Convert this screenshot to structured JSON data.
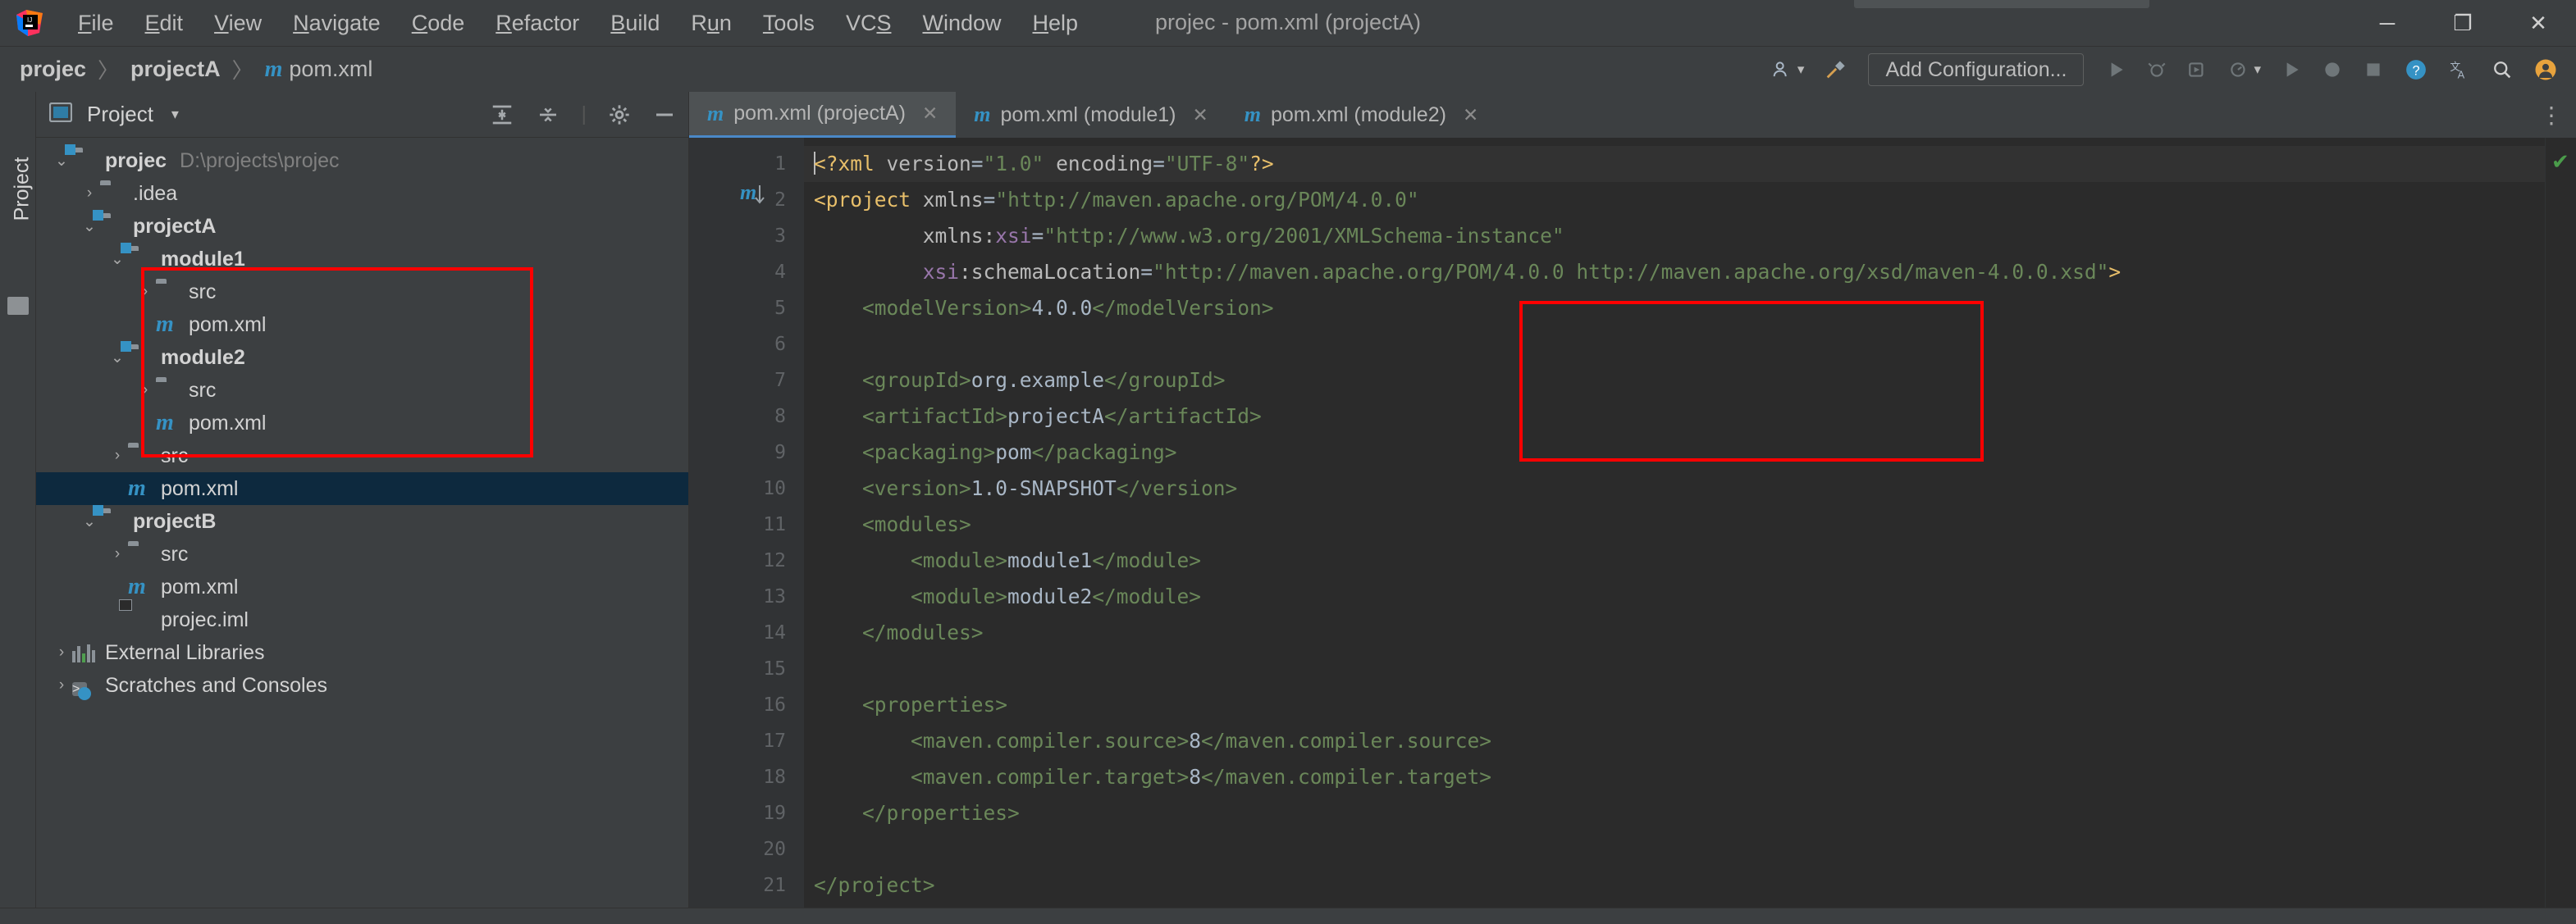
{
  "window": {
    "title": "projec - pom.xml (projectA)",
    "logo_icon": "intellij-idea-logo",
    "minimize_label": "─",
    "maximize_label": "❐",
    "close_label": "✕"
  },
  "menubar": {
    "items": [
      {
        "label": "File",
        "mnemonic": "F"
      },
      {
        "label": "Edit",
        "mnemonic": "E"
      },
      {
        "label": "View",
        "mnemonic": "V"
      },
      {
        "label": "Navigate",
        "mnemonic": "N"
      },
      {
        "label": "Code",
        "mnemonic": "C"
      },
      {
        "label": "Refactor",
        "mnemonic": "R"
      },
      {
        "label": "Build",
        "mnemonic": "B"
      },
      {
        "label": "Run",
        "mnemonic": "u"
      },
      {
        "label": "Tools",
        "mnemonic": "T"
      },
      {
        "label": "VCS",
        "mnemonic": "S"
      },
      {
        "label": "Window",
        "mnemonic": "W"
      },
      {
        "label": "Help",
        "mnemonic": "H"
      }
    ]
  },
  "navbar": {
    "crumbs": [
      {
        "label": "projec",
        "icon": ""
      },
      {
        "label": "projectA",
        "icon": ""
      },
      {
        "label": "pom.xml",
        "icon": "maven-m-icon"
      }
    ],
    "separator": "〉",
    "add_configuration_label": "Add Configuration...",
    "icons": {
      "user": "user-settings-icon",
      "hammer": "build-hammer-icon",
      "run": "run-icon",
      "debug": "debug-icon",
      "coverage": "run-with-coverage-icon",
      "profiler": "profiler-icon",
      "run2": "run-green-icon",
      "stop_record": "record-icon",
      "stop": "stop-icon",
      "help": "help-icon",
      "translate": "translate-icon",
      "search": "search-icon",
      "account": "account-icon",
      "more": "more-vertical-icon"
    }
  },
  "toolwindow": {
    "vertical_tab": "Project",
    "header_title": "Project",
    "header_caret": "▾",
    "tools": {
      "expand": "expand-all-icon",
      "collapse": "collapse-all-icon",
      "settings": "gear-icon",
      "hide": "hide-icon"
    }
  },
  "tree": {
    "items": [
      {
        "depth": 0,
        "arrow": "⌄",
        "icon": "module-folder-icon",
        "label": "projec",
        "bold": true,
        "path": "D:\\projects\\projec",
        "selected": false
      },
      {
        "depth": 1,
        "arrow": "›",
        "icon": "folder-icon",
        "label": ".idea",
        "bold": false,
        "path": "",
        "selected": false
      },
      {
        "depth": 1,
        "arrow": "⌄",
        "icon": "module-folder-icon",
        "label": "projectA",
        "bold": true,
        "path": "",
        "selected": false
      },
      {
        "depth": 2,
        "arrow": "⌄",
        "icon": "module-folder-icon",
        "label": "module1",
        "bold": true,
        "path": "",
        "selected": false
      },
      {
        "depth": 3,
        "arrow": "›",
        "icon": "folder-icon",
        "label": "src",
        "bold": false,
        "path": "",
        "selected": false
      },
      {
        "depth": 3,
        "arrow": "",
        "icon": "maven-m-icon",
        "label": "pom.xml",
        "bold": false,
        "path": "",
        "selected": false
      },
      {
        "depth": 2,
        "arrow": "⌄",
        "icon": "module-folder-icon",
        "label": "module2",
        "bold": true,
        "path": "",
        "selected": false
      },
      {
        "depth": 3,
        "arrow": "›",
        "icon": "folder-icon",
        "label": "src",
        "bold": false,
        "path": "",
        "selected": false
      },
      {
        "depth": 3,
        "arrow": "",
        "icon": "maven-m-icon",
        "label": "pom.xml",
        "bold": false,
        "path": "",
        "selected": false
      },
      {
        "depth": 2,
        "arrow": "›",
        "icon": "folder-icon",
        "label": "src",
        "bold": false,
        "path": "",
        "selected": false
      },
      {
        "depth": 2,
        "arrow": "",
        "icon": "maven-m-icon",
        "label": "pom.xml",
        "bold": false,
        "path": "",
        "selected": true
      },
      {
        "depth": 1,
        "arrow": "⌄",
        "icon": "module-folder-icon",
        "label": "projectB",
        "bold": true,
        "path": "",
        "selected": false
      },
      {
        "depth": 2,
        "arrow": "›",
        "icon": "folder-icon",
        "label": "src",
        "bold": false,
        "path": "",
        "selected": false
      },
      {
        "depth": 2,
        "arrow": "",
        "icon": "maven-m-icon",
        "label": "pom.xml",
        "bold": false,
        "path": "",
        "selected": false
      },
      {
        "depth": 2,
        "arrow": "",
        "icon": "iml-file-icon",
        "label": "projec.iml",
        "bold": false,
        "path": "",
        "selected": false
      },
      {
        "depth": 0,
        "arrow": "›",
        "icon": "libraries-icon",
        "label": "External Libraries",
        "bold": false,
        "path": "",
        "selected": false
      },
      {
        "depth": 0,
        "arrow": "›",
        "icon": "scratches-icon",
        "label": "Scratches and Consoles",
        "bold": false,
        "path": "",
        "selected": false
      }
    ]
  },
  "editor": {
    "tabs": [
      {
        "icon": "maven-m-icon",
        "label": "pom.xml (projectA)",
        "active": true,
        "close": "✕"
      },
      {
        "icon": "maven-m-icon",
        "label": "pom.xml (module1)",
        "active": false,
        "close": "✕"
      },
      {
        "icon": "maven-m-icon",
        "label": "pom.xml (module2)",
        "active": false,
        "close": "✕"
      }
    ],
    "more_icon": "more-vertical-icon",
    "inspection_status": "✔",
    "gutter_marker_icon": "maven-navigate-icon",
    "line_numbers": [
      "1",
      "2",
      "3",
      "4",
      "5",
      "6",
      "7",
      "8",
      "9",
      "10",
      "11",
      "12",
      "13",
      "14",
      "15",
      "16",
      "17",
      "18",
      "19",
      "20",
      "21"
    ],
    "fold_lines": [
      2,
      11,
      14,
      16,
      19,
      21
    ],
    "lines": [
      {
        "n": 1,
        "current": true,
        "caret": true,
        "segments": [
          {
            "t": "<?xml ",
            "c": "tag"
          },
          {
            "t": "version",
            "c": "attr"
          },
          {
            "t": "=",
            "c": "punc"
          },
          {
            "t": "\"1.0\"",
            "c": "str"
          },
          {
            "t": " ",
            "c": "punc"
          },
          {
            "t": "encoding",
            "c": "attr"
          },
          {
            "t": "=",
            "c": "punc"
          },
          {
            "t": "\"UTF-8\"",
            "c": "str"
          },
          {
            "t": "?>",
            "c": "tag"
          }
        ]
      },
      {
        "n": 2,
        "current": false,
        "caret": false,
        "segments": [
          {
            "t": "<project",
            "c": "tag"
          },
          {
            "t": " ",
            "c": "punc"
          },
          {
            "t": "xmlns",
            "c": "attr"
          },
          {
            "t": "=",
            "c": "punc"
          },
          {
            "t": "\"http://maven.apache.org/POM/4.0.0\"",
            "c": "str"
          }
        ]
      },
      {
        "n": 3,
        "current": false,
        "caret": false,
        "segments": [
          {
            "t": "         ",
            "c": "punc"
          },
          {
            "t": "xmlns:",
            "c": "attr"
          },
          {
            "t": "xsi",
            "c": "attrns"
          },
          {
            "t": "=",
            "c": "punc"
          },
          {
            "t": "\"http://www.w3.org/2001/XMLSchema-instance\"",
            "c": "str"
          }
        ]
      },
      {
        "n": 4,
        "current": false,
        "caret": false,
        "segments": [
          {
            "t": "         ",
            "c": "punc"
          },
          {
            "t": "xsi",
            "c": "attrns"
          },
          {
            "t": ":schemaLocation",
            "c": "attr"
          },
          {
            "t": "=",
            "c": "punc"
          },
          {
            "t": "\"http://maven.apache.org/POM/4.0.0 http://maven.apache.org/xsd/maven-4.0.0.xsd\"",
            "c": "str"
          },
          {
            "t": ">",
            "c": "tag"
          }
        ]
      },
      {
        "n": 5,
        "current": false,
        "caret": false,
        "segments": [
          {
            "t": "    ",
            "c": "punc"
          },
          {
            "t": "<modelVersion>",
            "c": "tag2"
          },
          {
            "t": "4.0.0",
            "c": "txt"
          },
          {
            "t": "</modelVersion>",
            "c": "tag2"
          }
        ]
      },
      {
        "n": 6,
        "current": false,
        "caret": false,
        "segments": []
      },
      {
        "n": 7,
        "current": false,
        "caret": false,
        "segments": [
          {
            "t": "    ",
            "c": "punc"
          },
          {
            "t": "<groupId>",
            "c": "tag2"
          },
          {
            "t": "org.example",
            "c": "txt"
          },
          {
            "t": "</groupId>",
            "c": "tag2"
          }
        ]
      },
      {
        "n": 8,
        "current": false,
        "caret": false,
        "segments": [
          {
            "t": "    ",
            "c": "punc"
          },
          {
            "t": "<artifactId>",
            "c": "tag2"
          },
          {
            "t": "projectA",
            "c": "txt"
          },
          {
            "t": "</artifactId>",
            "c": "tag2"
          }
        ]
      },
      {
        "n": 9,
        "current": false,
        "caret": false,
        "segments": [
          {
            "t": "    ",
            "c": "punc"
          },
          {
            "t": "<packaging>",
            "c": "tag2"
          },
          {
            "t": "pom",
            "c": "txt"
          },
          {
            "t": "</packaging>",
            "c": "tag2"
          }
        ]
      },
      {
        "n": 10,
        "current": false,
        "caret": false,
        "segments": [
          {
            "t": "    ",
            "c": "punc"
          },
          {
            "t": "<version>",
            "c": "tag2"
          },
          {
            "t": "1.0-SNAPSHOT",
            "c": "txt"
          },
          {
            "t": "</version>",
            "c": "tag2"
          }
        ]
      },
      {
        "n": 11,
        "current": false,
        "caret": false,
        "segments": [
          {
            "t": "    ",
            "c": "punc"
          },
          {
            "t": "<modules>",
            "c": "tag2"
          }
        ]
      },
      {
        "n": 12,
        "current": false,
        "caret": false,
        "segments": [
          {
            "t": "        ",
            "c": "punc"
          },
          {
            "t": "<module>",
            "c": "tag2"
          },
          {
            "t": "module1",
            "c": "txt"
          },
          {
            "t": "</module>",
            "c": "tag2"
          }
        ]
      },
      {
        "n": 13,
        "current": false,
        "caret": false,
        "segments": [
          {
            "t": "        ",
            "c": "punc"
          },
          {
            "t": "<module>",
            "c": "tag2"
          },
          {
            "t": "module2",
            "c": "txt"
          },
          {
            "t": "</module>",
            "c": "tag2"
          }
        ]
      },
      {
        "n": 14,
        "current": false,
        "caret": false,
        "segments": [
          {
            "t": "    ",
            "c": "punc"
          },
          {
            "t": "</modules>",
            "c": "tag2"
          }
        ]
      },
      {
        "n": 15,
        "current": false,
        "caret": false,
        "segments": []
      },
      {
        "n": 16,
        "current": false,
        "caret": false,
        "segments": [
          {
            "t": "    ",
            "c": "punc"
          },
          {
            "t": "<properties>",
            "c": "tag2"
          }
        ]
      },
      {
        "n": 17,
        "current": false,
        "caret": false,
        "segments": [
          {
            "t": "        ",
            "c": "punc"
          },
          {
            "t": "<maven.compiler.source>",
            "c": "tag2"
          },
          {
            "t": "8",
            "c": "txt"
          },
          {
            "t": "</maven.compiler.source>",
            "c": "tag2"
          }
        ]
      },
      {
        "n": 18,
        "current": false,
        "caret": false,
        "segments": [
          {
            "t": "        ",
            "c": "punc"
          },
          {
            "t": "<maven.compiler.target>",
            "c": "tag2"
          },
          {
            "t": "8",
            "c": "txt"
          },
          {
            "t": "</maven.compiler.target>",
            "c": "tag2"
          }
        ]
      },
      {
        "n": 19,
        "current": false,
        "caret": false,
        "segments": [
          {
            "t": "    ",
            "c": "punc"
          },
          {
            "t": "</properties>",
            "c": "tag2"
          }
        ]
      },
      {
        "n": 20,
        "current": false,
        "caret": false,
        "segments": []
      },
      {
        "n": 21,
        "current": false,
        "caret": false,
        "segments": [
          {
            "t": "</project>",
            "c": "tag2"
          }
        ]
      }
    ]
  },
  "annotations": {
    "tree_highlight": "red-rectangle-modules-tree",
    "code_highlight": "red-rectangle-modules-xml",
    "color": "#ff0000"
  }
}
